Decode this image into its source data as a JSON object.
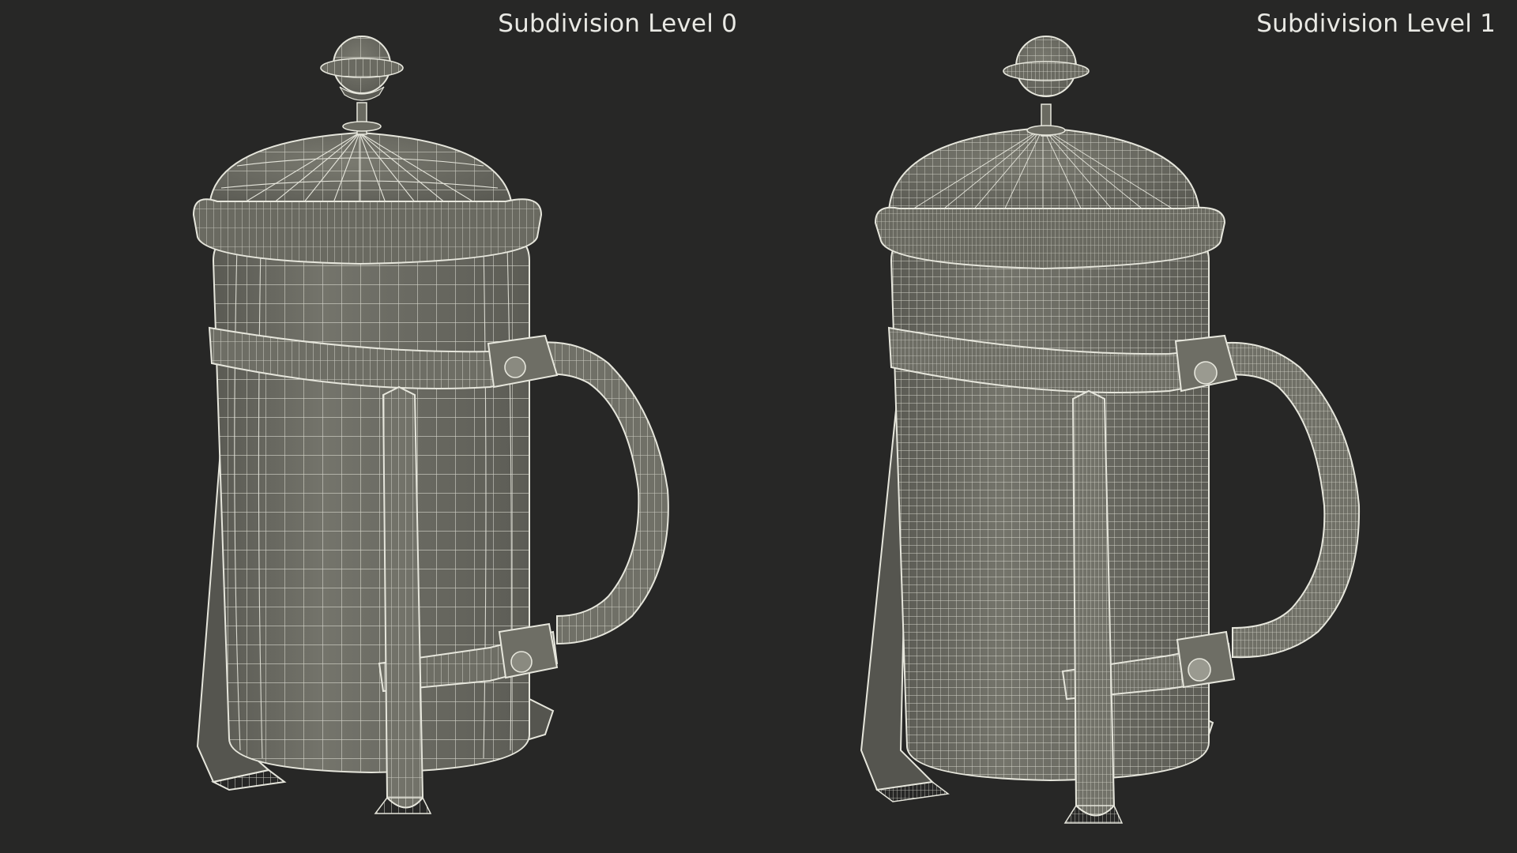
{
  "labels": {
    "left": "Subdivision Level 0",
    "right": "Subdivision Level 1"
  },
  "render": {
    "background": "#272726",
    "mesh_fill": "#6b6b63",
    "mesh_fill_shadow": "#55554f",
    "wire_color": "#e6e6dc",
    "subjects": [
      {
        "name": "french-press-level-0",
        "subdivision_level": 0
      },
      {
        "name": "french-press-level-1",
        "subdivision_level": 1
      }
    ]
  }
}
